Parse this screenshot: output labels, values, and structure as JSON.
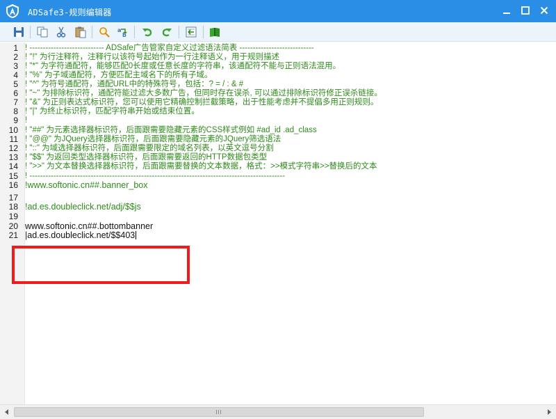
{
  "window": {
    "title": "ADSafe3-规则编辑器",
    "icon": "adsafe-shield-icon",
    "controls": [
      "minimize-icon",
      "maximize-icon",
      "close-icon"
    ]
  },
  "toolbar": {
    "buttons": [
      "save-icon",
      "copy-icon",
      "cut-icon",
      "paste-icon",
      "find-icon",
      "replace-icon",
      "undo-icon",
      "redo-icon",
      "goto-line-icon",
      "book-icon"
    ]
  },
  "editor": {
    "lines": [
      {
        "num": "1",
        "text": "! ---------------------------- ADSafe广告管家自定义过滤语法简表 ----------------------------",
        "kind": "comment"
      },
      {
        "num": "2",
        "text": "! \"!\" 为行注释符，注释行以该符号起始作为一行注释语义，用于规则描述",
        "kind": "comment"
      },
      {
        "num": "3",
        "text": "! \"*\" 为字符通配符，能够匹配0长度或任意长度的字符串，该通配符不能与正则语法混用。",
        "kind": "comment"
      },
      {
        "num": "4",
        "text": "! \"%\" 为子域通配符，方便匹配主域名下的所有子域。",
        "kind": "comment"
      },
      {
        "num": "5",
        "text": "! \"^\" 为符号通配符，通配URL中的特殊符号，包括：? = / : & #",
        "kind": "comment"
      },
      {
        "num": "6",
        "text": "! \"~\" 为排除标识符，通配符能过滤大多数广告，但同时存在误杀, 可以通过排除标识符修正误杀链接。",
        "kind": "comment"
      },
      {
        "num": "7",
        "text": "! \"&\" 为正则表达式标识符，您可以使用它精确控制拦截策略，出于性能考虑并不提倡多用正则规则。",
        "kind": "comment"
      },
      {
        "num": "8",
        "text": "! \"|\" 为终止标识符，匹配字符串开始或结束位置。",
        "kind": "comment"
      },
      {
        "num": "9",
        "text": "!",
        "kind": "comment"
      },
      {
        "num": "10",
        "text": "! \"##\" 为元素选择器标识符，后面跟需要隐藏元素的CSS样式例如 #ad_id  .ad_class",
        "kind": "comment"
      },
      {
        "num": "11",
        "text": "! \"@@\" 为JQuery选择器标识符，后面跟需要隐藏元素的JQuery筛选语法",
        "kind": "comment"
      },
      {
        "num": "12",
        "text": "! \"::\" 为域选择器标识符，后面跟需要限定的域名列表，以英文逗号分割",
        "kind": "comment"
      },
      {
        "num": "13",
        "text": "! \"$$\" 为返回类型选择器标识符，后面跟需要返回的HTTP数据包类型",
        "kind": "comment"
      },
      {
        "num": "14",
        "text": "! \">>\" 为文本替换选择器标识符，后面跟需要替换的文本数据，格式：>>模式字符串>>替换后的文本",
        "kind": "comment"
      },
      {
        "num": "15",
        "text": "! ------------------------------------------------------------------------------------------------",
        "kind": "comment"
      },
      {
        "num": "16",
        "text": "!www.softonic.cn##.banner_box",
        "kind": "comment"
      },
      {
        "num": "17",
        "text": "",
        "kind": "comment"
      },
      {
        "num": "18",
        "text": "!ad.es.doubleclick.net/adj/$$js",
        "kind": "comment"
      },
      {
        "num": "19",
        "text": "",
        "kind": "plain"
      },
      {
        "num": "20",
        "text": "www.softonic.cn##.bottombanner",
        "kind": "plain"
      },
      {
        "num": "21",
        "text": "|ad.es.doubleclick.net/$$403",
        "kind": "plain"
      }
    ]
  },
  "colors": {
    "titlebar": "#2a8ee6",
    "comment": "#2e8b1a",
    "highlight": "#ee1c1c"
  }
}
